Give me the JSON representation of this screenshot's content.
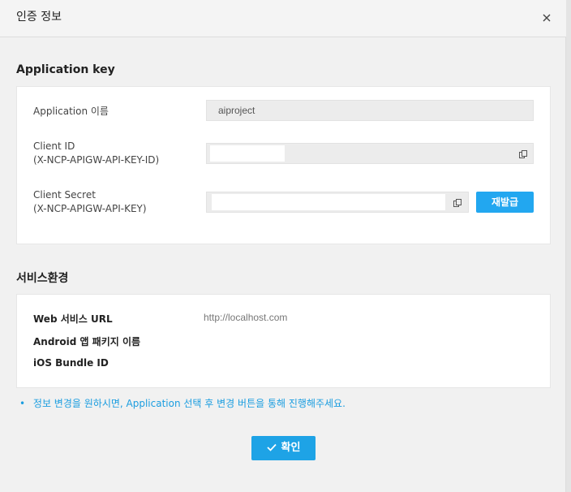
{
  "dialog": {
    "title": "인증 정보",
    "close_icon": "close-icon"
  },
  "application_key": {
    "section_title": "Application key",
    "app_name_label": "Application 이름",
    "app_name_value": "aiproject",
    "client_id_label_1": "Client ID",
    "client_id_label_2": "(X-NCP-APIGW-API-KEY-ID)",
    "client_secret_label_1": "Client Secret",
    "client_secret_label_2": "(X-NCP-APIGW-API-KEY)",
    "copy_icon": "copy-icon",
    "reissue_label": "재발급"
  },
  "service_env": {
    "section_title": "서비스환경",
    "web_url_label": "Web 서비스 URL",
    "web_url_value": "http://localhost.com",
    "android_label": "Android 앱 패키지 이름",
    "ios_label": "iOS Bundle ID"
  },
  "notice": {
    "bullet": "•",
    "text": "정보 변경을 원하시면, Application 선택 후 변경 버튼을 통해 진행해주세요."
  },
  "footer": {
    "confirm_label": "확인",
    "check_icon": "check-icon"
  },
  "colors": {
    "accent": "#1ea3e6",
    "notice": "#1a9de0"
  }
}
